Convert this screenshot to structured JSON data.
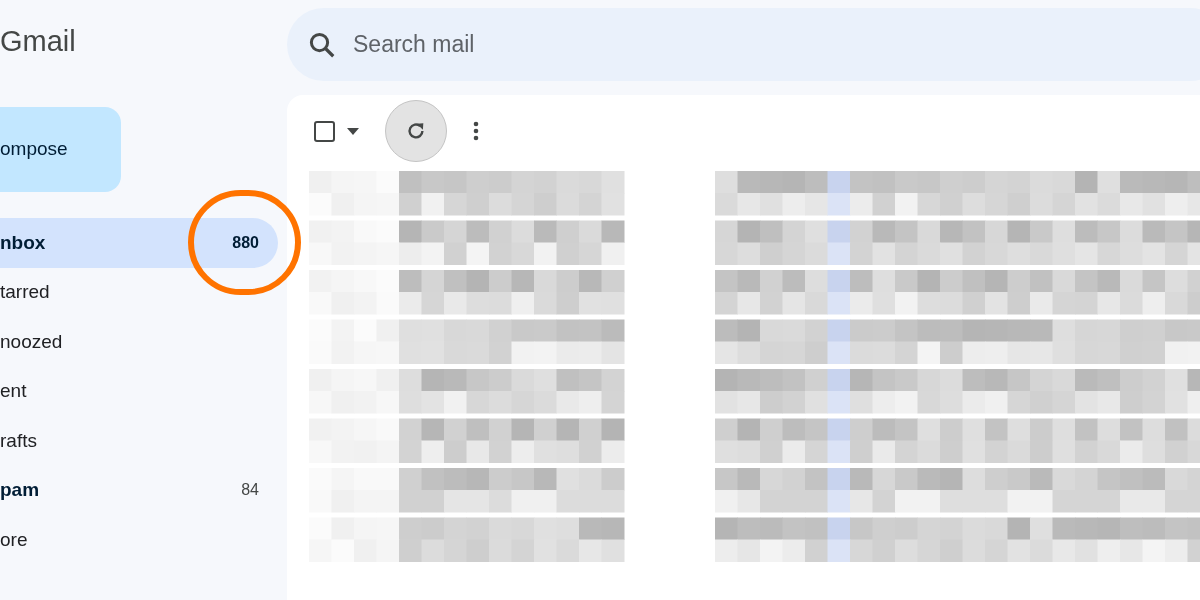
{
  "app": {
    "title": "Gmail"
  },
  "search": {
    "placeholder": "Search mail"
  },
  "compose": {
    "label": "ompose"
  },
  "nav": [
    {
      "label": "nbox",
      "count": "880",
      "selected": true,
      "unread": true,
      "highlighted": true
    },
    {
      "label": "tarred",
      "selected": false,
      "unread": false,
      "highlighted": false
    },
    {
      "label": "noozed",
      "selected": false,
      "unread": false,
      "highlighted": false
    },
    {
      "label": "ent",
      "selected": false,
      "unread": false,
      "highlighted": false
    },
    {
      "label": "rafts",
      "selected": false,
      "unread": false,
      "highlighted": false
    },
    {
      "label": "pam",
      "count": "84",
      "selected": false,
      "unread": true,
      "highlighted": false
    },
    {
      "label": "ore",
      "selected": false,
      "unread": false,
      "highlighted": false
    }
  ],
  "toolbar": {
    "select_all": {
      "checked": false
    }
  }
}
